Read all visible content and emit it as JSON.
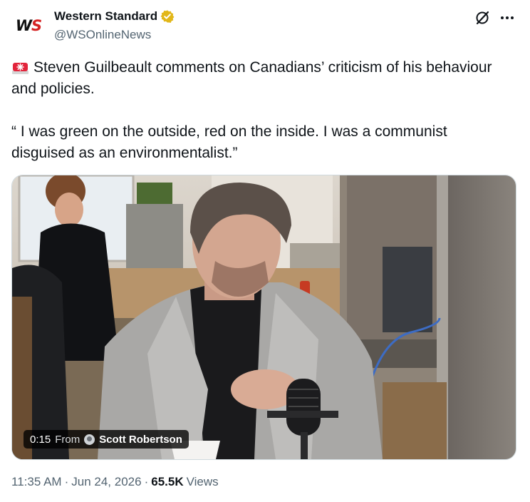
{
  "author": {
    "avatar_letters": [
      "W",
      "S"
    ],
    "name": "Western Standard",
    "handle": "@WSOnlineNews",
    "verified_badge_color": "#e2b719"
  },
  "header_actions": {
    "grok": "grok-icon",
    "more": "more-icon"
  },
  "tweet": {
    "siren_emoji": "siren-icon",
    "line1": "Steven Guilbeault comments on Canadians’ criticism of his behaviour and policies.",
    "quote": "“ I was green on the outside, red on the inside. I was a communist disguised as an environmentalist.”"
  },
  "video": {
    "duration": "0:15",
    "from_label": "From",
    "creator": "Scott Robertson"
  },
  "meta": {
    "time": "11:35 AM",
    "separator": "·",
    "date": "Jun 24, 2026",
    "views_count": "65.5K",
    "views_label": "Views"
  },
  "colors": {
    "text": "#0f1419",
    "secondary": "#536471",
    "border": "#cfd9de",
    "logo_red": "#d52323"
  }
}
